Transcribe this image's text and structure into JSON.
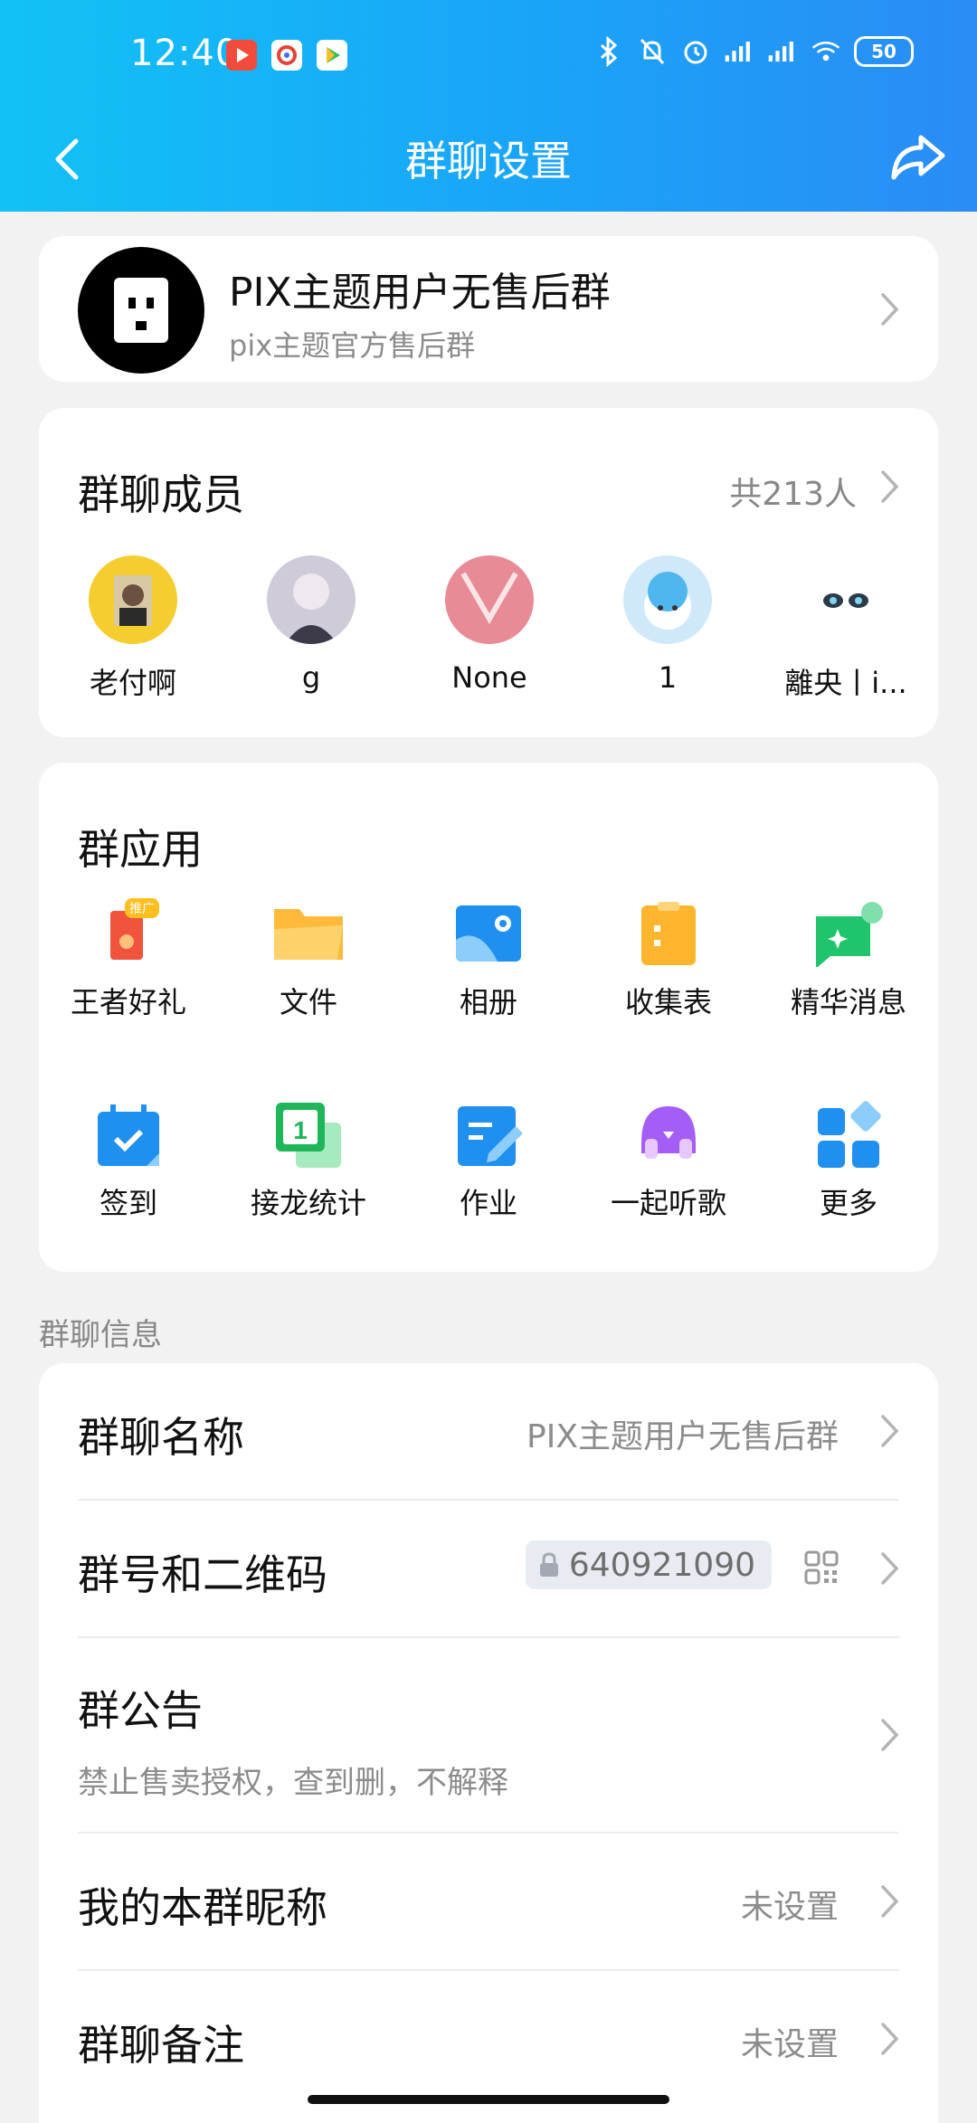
{
  "status_bar": {
    "time": "12:40",
    "battery": "50"
  },
  "nav": {
    "title": "群聊设置"
  },
  "group": {
    "name": "PIX主题用户无售后群",
    "subtitle": "pix主题官方售后群"
  },
  "members": {
    "title": "群聊成员",
    "count": "共213人",
    "list": [
      {
        "name": "老付啊"
      },
      {
        "name": "g"
      },
      {
        "name": "None"
      },
      {
        "name": "1"
      },
      {
        "name": "離央丨i..."
      }
    ]
  },
  "apps": {
    "title": "群应用",
    "badge": "推广",
    "items": [
      {
        "label": "王者好礼",
        "icon": "gift-card-icon",
        "color": "#f0543c"
      },
      {
        "label": "文件",
        "icon": "folder-icon",
        "color": "#ffb93b"
      },
      {
        "label": "相册",
        "icon": "photo-album-icon",
        "color": "#1f8ff0"
      },
      {
        "label": "收集表",
        "icon": "clipboard-icon",
        "color": "#ffb62e"
      },
      {
        "label": "精华消息",
        "icon": "star-message-icon",
        "color": "#20c46d"
      },
      {
        "label": "签到",
        "icon": "calendar-check-icon",
        "color": "#1f8ff0"
      },
      {
        "label": "接龙统计",
        "icon": "relay-count-icon",
        "color": "#1fb65a"
      },
      {
        "label": "作业",
        "icon": "homework-icon",
        "color": "#1f8ff0"
      },
      {
        "label": "一起听歌",
        "icon": "music-headphones-icon",
        "color": "#a55ef5"
      },
      {
        "label": "更多",
        "icon": "more-grid-icon",
        "color": "#1f8ff0"
      }
    ]
  },
  "info": {
    "section_label": "群聊信息",
    "group_name_title": "群聊名称",
    "group_name_value": "PIX主题用户无售后群",
    "group_number_title": "群号和二维码",
    "group_number_value": "640921090",
    "announcement_title": "群公告",
    "announcement_value": "禁止售卖授权，查到删，不解释",
    "nickname_title": "我的本群昵称",
    "nickname_value": "未设置",
    "remark_title": "群聊备注",
    "remark_value": "未设置"
  }
}
